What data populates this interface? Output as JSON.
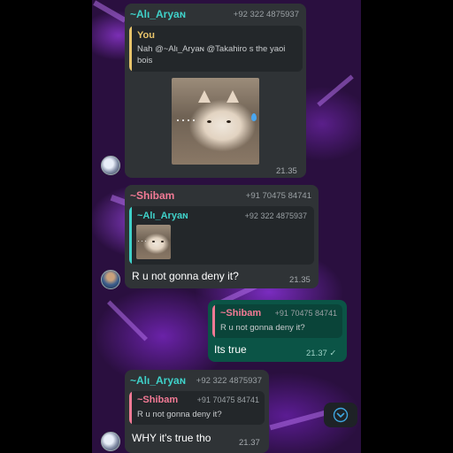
{
  "colors": {
    "name_aryan": "#3fd1c9",
    "name_shibam": "#f27a95",
    "you": "#e8c46b",
    "incoming_bubble": "#2f3336",
    "outgoing_bubble": "#0b5446",
    "read_tick": "#9fd3c7"
  },
  "messages": [
    {
      "sender": "~Alι_Aryaɴ",
      "phone": "+92 322 4875937",
      "quote": {
        "name": "You",
        "text": "Nah @~Alι_Aryaɴ @Takahiro s the yaoi bois"
      },
      "media": "cat-photo",
      "time": "21.35"
    },
    {
      "sender": "~Shibam",
      "phone": "+91 70475 84741",
      "quote": {
        "name": "~Alι_Aryaɴ",
        "phone": "+92 322 4875937",
        "media": "cat-photo-thumbnail"
      },
      "text": "R u not gonna deny it?",
      "time": "21.35"
    },
    {
      "sender": "me",
      "quote": {
        "name": "~Shibam",
        "phone": "+91 70475 84741",
        "text": "R u not gonna deny it?"
      },
      "text": "Its true",
      "time": "21.37 ✓"
    },
    {
      "sender": "~Alι_Aryaɴ",
      "phone": "+92 322 4875937",
      "quote": {
        "name": "~Shibam",
        "phone": "+91 70475 84741",
        "text": "R u not gonna deny it?"
      },
      "text": "WHY it's true tho",
      "time": "21.37"
    }
  ],
  "icons": {
    "scroll_down": "chevron-down-icon"
  }
}
